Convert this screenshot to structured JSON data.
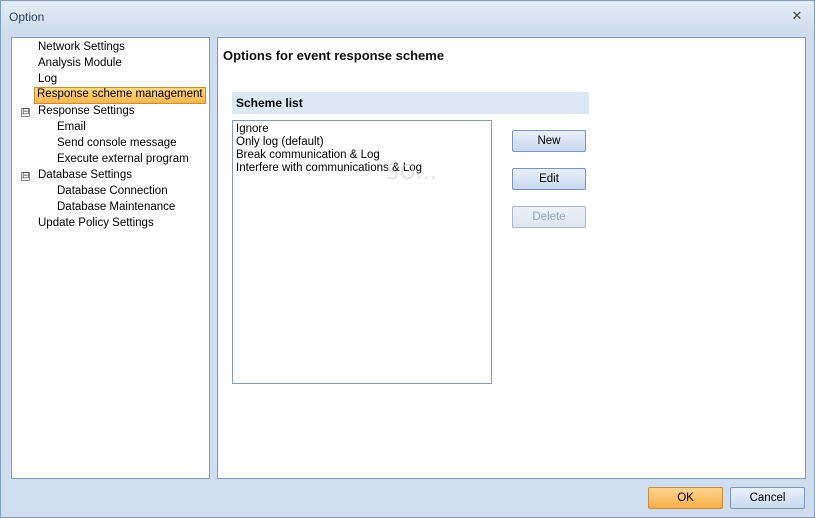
{
  "window": {
    "title": "Option",
    "close_glyph": "✕"
  },
  "tree": {
    "items": [
      {
        "label": "Network Settings"
      },
      {
        "label": "Analysis Module"
      },
      {
        "label": "Log"
      },
      {
        "label": "Response scheme management"
      },
      {
        "label": "Response Settings",
        "expander": "⊟"
      },
      {
        "label": "Email"
      },
      {
        "label": "Send console message"
      },
      {
        "label": "Execute external program"
      },
      {
        "label": "Database Settings",
        "expander": "⊟"
      },
      {
        "label": "Database Connection"
      },
      {
        "label": "Database Maintenance"
      },
      {
        "label": "Update Policy Settings"
      }
    ]
  },
  "main": {
    "heading": "Options for event response scheme",
    "scheme_list_label": "Scheme list",
    "schemes": [
      "Ignore",
      "Only log (default)",
      "Break communication & Log",
      "Interfere with communications & Log"
    ],
    "buttons": {
      "new": "New",
      "edit": "Edit",
      "delete": "Delete"
    }
  },
  "footer": {
    "ok": "OK",
    "cancel": "Cancel"
  },
  "watermark": "SO...",
  "colors": {
    "selection": "#f9b54f",
    "window_bg": "#cfddee",
    "panel_border": "#7f9db9"
  }
}
